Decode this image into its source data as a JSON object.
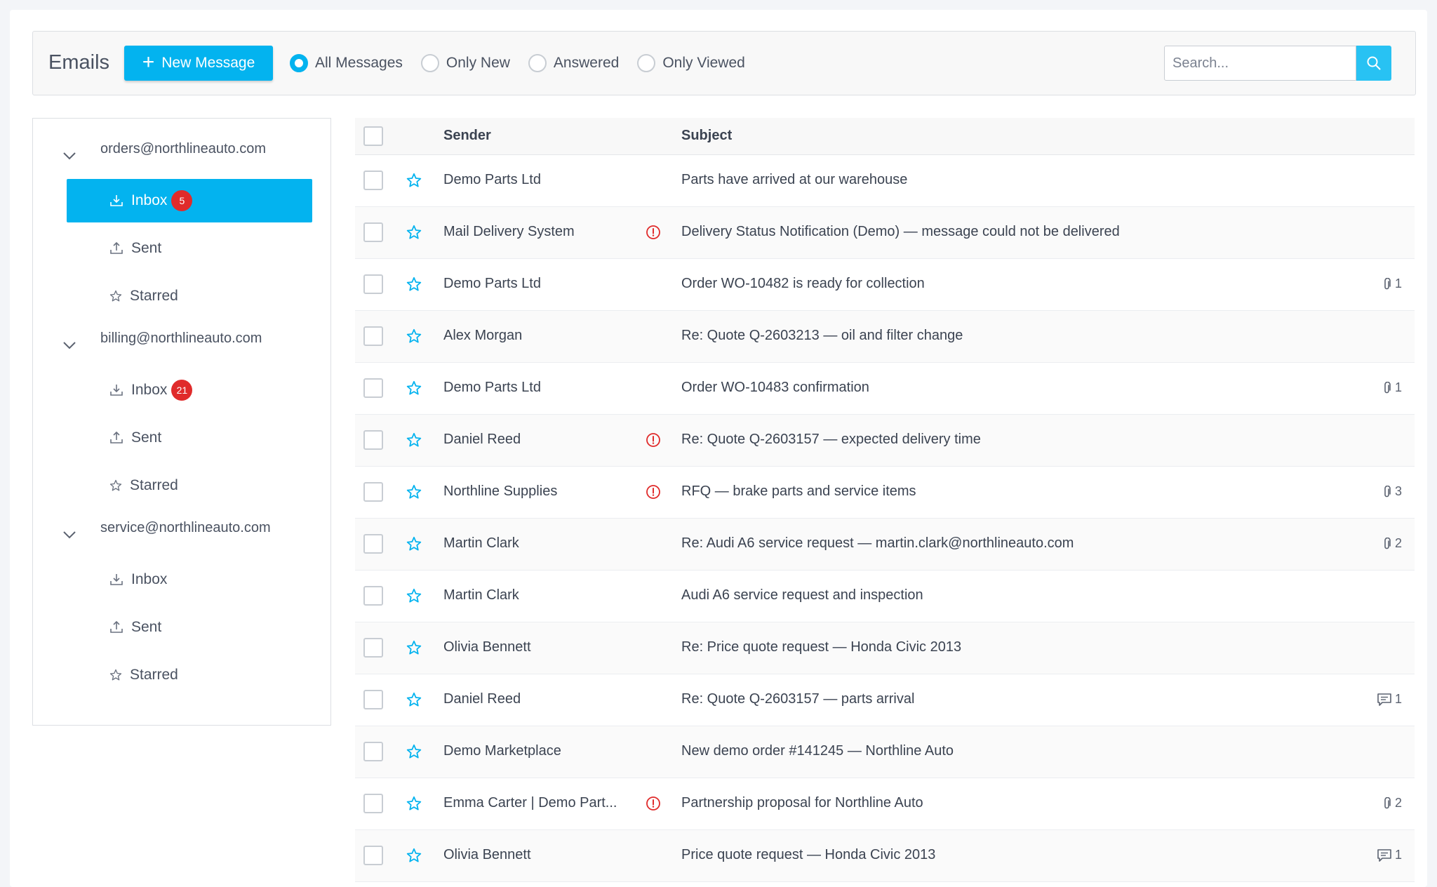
{
  "toolbar": {
    "title": "Emails",
    "new_message_label": "New Message",
    "filters": [
      {
        "label": "All Messages",
        "selected": true
      },
      {
        "label": "Only New",
        "selected": false
      },
      {
        "label": "Answered",
        "selected": false
      },
      {
        "label": "Only Viewed",
        "selected": false
      }
    ],
    "search_placeholder": "Search..."
  },
  "sidebar": {
    "accounts": [
      {
        "email": "orders@northlineauto.com",
        "folders": [
          {
            "label": "Inbox",
            "badge": "5",
            "active": true
          },
          {
            "label": "Sent",
            "badge": "",
            "active": false
          },
          {
            "label": "Starred",
            "badge": "",
            "active": false
          }
        ]
      },
      {
        "email": "billing@northlineauto.com",
        "folders": [
          {
            "label": "Inbox",
            "badge": "21",
            "active": false
          },
          {
            "label": "Sent",
            "badge": "",
            "active": false
          },
          {
            "label": "Starred",
            "badge": "",
            "active": false
          }
        ]
      },
      {
        "email": "service@northlineauto.com",
        "folders": [
          {
            "label": "Inbox",
            "badge": "",
            "active": false
          },
          {
            "label": "Sent",
            "badge": "",
            "active": false
          },
          {
            "label": "Starred",
            "badge": "",
            "active": false
          }
        ]
      }
    ]
  },
  "list": {
    "columns": {
      "sender": "Sender",
      "subject": "Subject"
    },
    "rows": [
      {
        "sender": "Demo Parts Ltd",
        "alert": false,
        "subject": "Parts have arrived at our warehouse",
        "meta_icon": "",
        "meta_count": ""
      },
      {
        "sender": "Mail Delivery System",
        "alert": true,
        "subject": "Delivery Status Notification (Demo) — message could not be delivered",
        "meta_icon": "",
        "meta_count": ""
      },
      {
        "sender": "Demo Parts Ltd",
        "alert": false,
        "subject": "Order WO-10482 is ready for collection",
        "meta_icon": "paperclip-icon",
        "meta_count": "1"
      },
      {
        "sender": "Alex Morgan",
        "alert": false,
        "subject": "Re: Quote Q-2603213 — oil and filter change",
        "meta_icon": "",
        "meta_count": ""
      },
      {
        "sender": "Demo Parts Ltd",
        "alert": false,
        "subject": "Order WO-10483 confirmation",
        "meta_icon": "paperclip-icon",
        "meta_count": "1"
      },
      {
        "sender": "Daniel Reed",
        "alert": true,
        "subject": "Re: Quote Q-2603157 — expected delivery time",
        "meta_icon": "",
        "meta_count": ""
      },
      {
        "sender": "Northline Supplies",
        "alert": true,
        "subject": "RFQ — brake parts and service items",
        "meta_icon": "paperclip-icon",
        "meta_count": "3"
      },
      {
        "sender": "Martin Clark",
        "alert": false,
        "subject": "Re: Audi A6 service request — martin.clark@northlineauto.com",
        "meta_icon": "paperclip-icon",
        "meta_count": "2"
      },
      {
        "sender": "Martin Clark",
        "alert": false,
        "subject": "Audi A6 service request and inspection",
        "meta_icon": "",
        "meta_count": ""
      },
      {
        "sender": "Olivia Bennett",
        "alert": false,
        "subject": "Re: Price quote request — Honda Civic 2013",
        "meta_icon": "",
        "meta_count": ""
      },
      {
        "sender": "Daniel Reed",
        "alert": false,
        "subject": "Re: Quote Q-2603157 — parts arrival",
        "meta_icon": "comment-icon",
        "meta_count": "1"
      },
      {
        "sender": "Demo Marketplace",
        "alert": false,
        "subject": "New demo order #141245 — Northline Auto",
        "meta_icon": "",
        "meta_count": ""
      },
      {
        "sender": "Emma Carter | Demo Part...",
        "alert": true,
        "subject": "Partnership proposal for Northline Auto",
        "meta_icon": "paperclip-icon",
        "meta_count": "2"
      },
      {
        "sender": "Olivia Bennett",
        "alert": false,
        "subject": "Price quote request — Honda Civic 2013",
        "meta_icon": "comment-icon",
        "meta_count": "1"
      }
    ]
  },
  "colors": {
    "accent": "#03b3ef",
    "badge": "#e02b2b",
    "alert": "#e02b2b"
  }
}
